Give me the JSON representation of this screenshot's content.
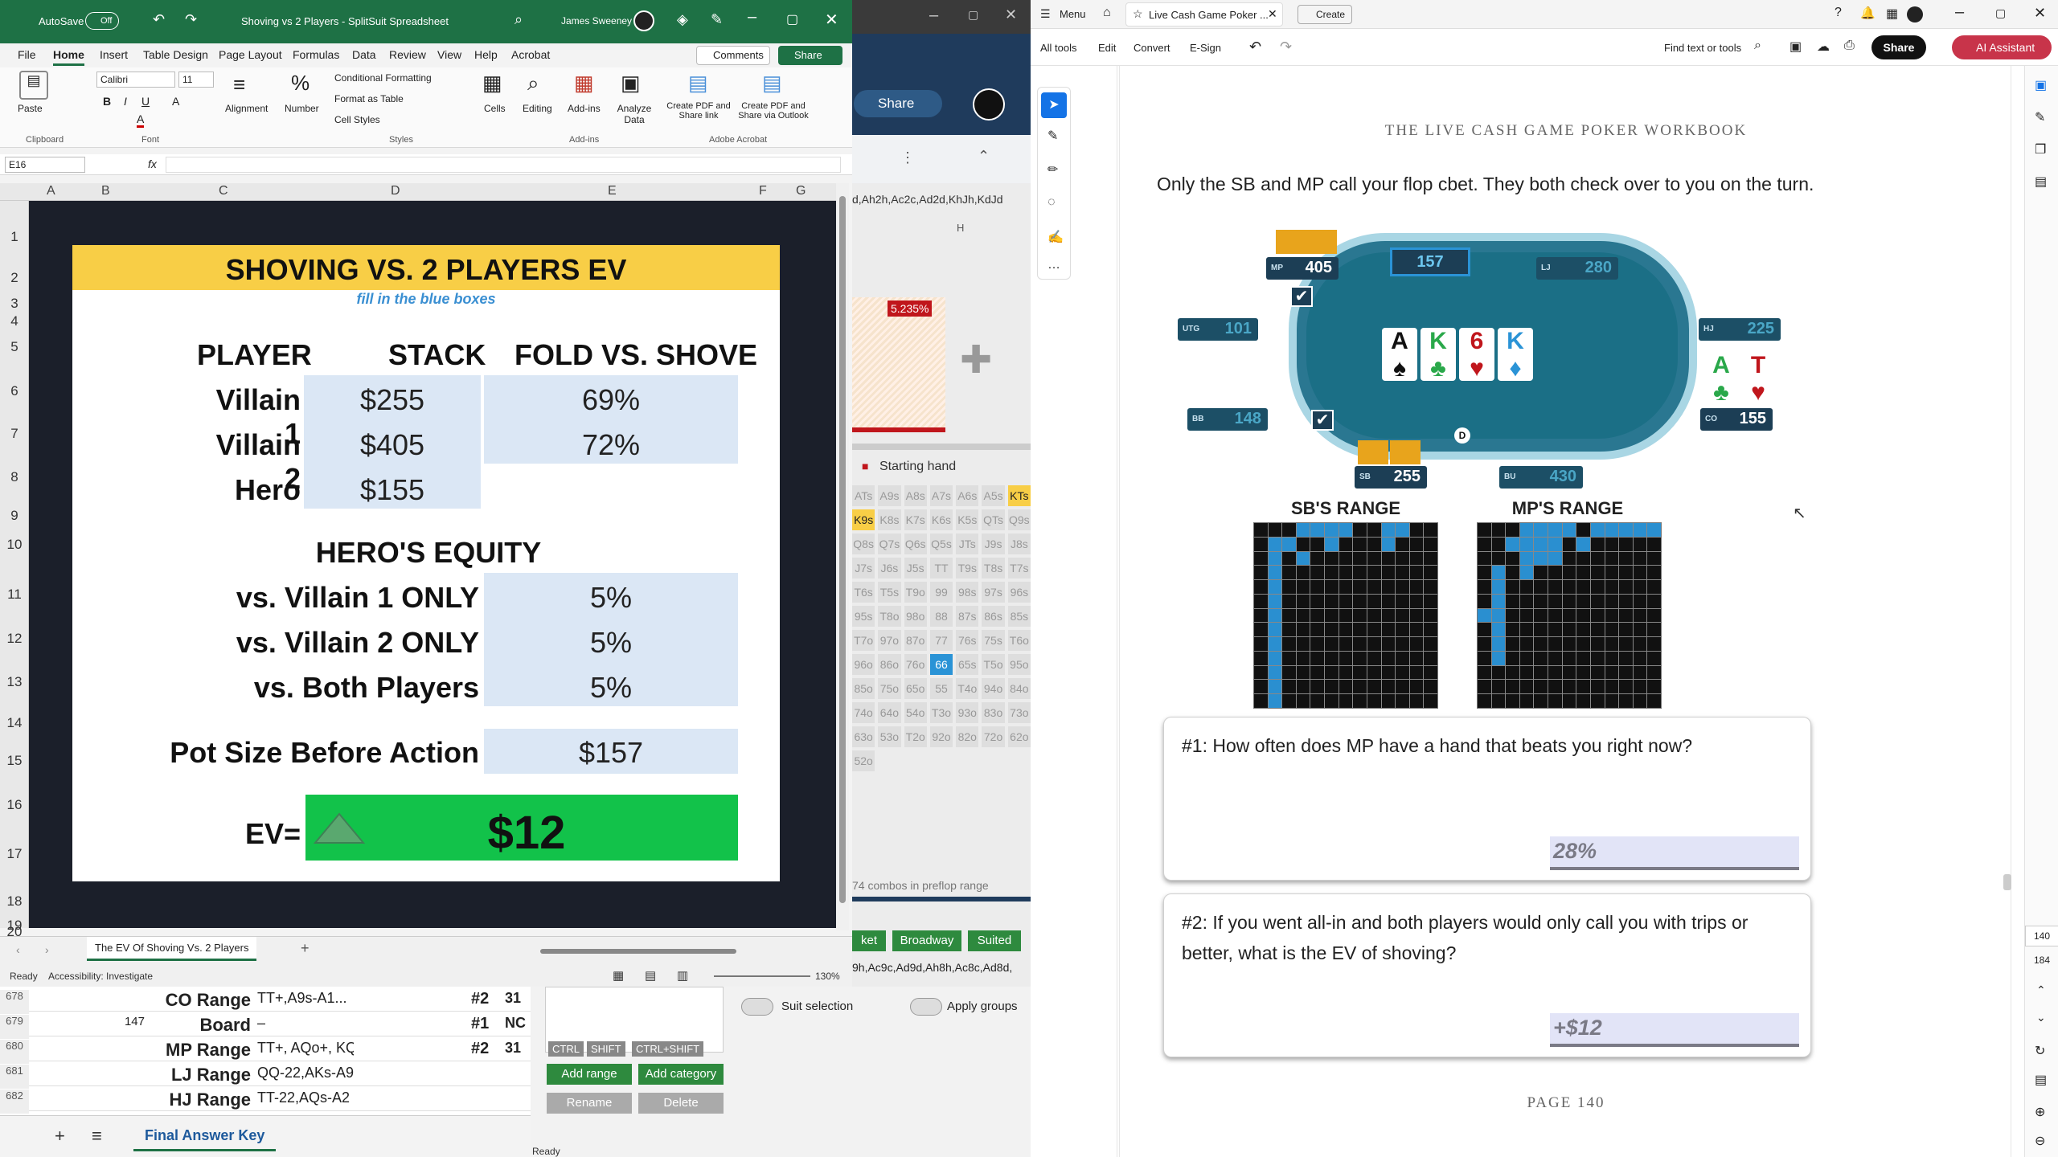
{
  "excel": {
    "autosave": "AutoSave",
    "autosave_state": "Off",
    "file_title": "Shoving vs 2 Players - SplitSuit Spreadsheet",
    "user": "James Sweeney",
    "tabs": [
      "File",
      "Home",
      "Insert",
      "Table Design",
      "Page Layout",
      "Formulas",
      "Data",
      "Review",
      "View",
      "Help",
      "Acrobat"
    ],
    "comments_label": "Comments",
    "share_label": "Share",
    "ribbon": {
      "paste": "Paste",
      "font_name": "Calibri",
      "font_size": "11",
      "alignment": "Alignment",
      "number": "Number",
      "cond_fmt": "Conditional Formatting",
      "format_table": "Format as Table",
      "cell_styles": "Cell Styles",
      "cells": "Cells",
      "editing": "Editing",
      "addins": "Add-ins",
      "analyze": "Analyze Data",
      "create_pdf": "Create PDF and Share link",
      "create_pdf_outlook": "Create PDF and Share via Outlook",
      "grp_clipboard": "Clipboard",
      "grp_font": "Font",
      "grp_styles": "Styles",
      "grp_addins": "Add-ins",
      "grp_acrobat": "Adobe Acrobat"
    },
    "name_box": "E16",
    "fx": "fx",
    "columns": [
      "A",
      "B",
      "C",
      "D",
      "E",
      "F",
      "G"
    ],
    "rows": [
      "1",
      "2",
      "3",
      "4",
      "5",
      "6",
      "7",
      "8",
      "9",
      "10",
      "11",
      "12",
      "13",
      "14",
      "15",
      "16",
      "17",
      "18",
      "19",
      "20"
    ],
    "sheet_tab": "The EV Of Shoving Vs. 2 Players",
    "status_ready": "Ready",
    "accessibility": "Accessibility: Investigate",
    "zoom": "130%"
  },
  "card": {
    "title": "SHOVING VS. 2 PLAYERS EV",
    "subtitle": "fill in the blue boxes",
    "hdr_player": "PLAYER",
    "hdr_stack": "STACK",
    "hdr_fold": "FOLD VS. SHOVE",
    "players": [
      {
        "name": "Villain 1",
        "stack": "$255",
        "fold": "69%"
      },
      {
        "name": "Villain 2",
        "stack": "$405",
        "fold": "72%"
      },
      {
        "name": "Hero",
        "stack": "$155",
        "fold": ""
      }
    ],
    "equity_hdr": "HERO'S EQUITY",
    "equity": [
      {
        "label": "vs. Villain 1 ONLY",
        "value": "5%"
      },
      {
        "label": "vs. Villain 2 ONLY",
        "value": "5%"
      },
      {
        "label": "vs. Both Players",
        "value": "5%"
      }
    ],
    "pot_label": "Pot Size Before Action",
    "pot_value": "$157",
    "ev_label": "EV=",
    "ev_value": "$12"
  },
  "excel_lower": {
    "rows": [
      {
        "num": "678",
        "b": "",
        "c": "CO Range",
        "d": "TT+,A9s-A1...",
        "e": "#2",
        "f": "31"
      },
      {
        "num": "679",
        "b": "147",
        "c": "Board",
        "d": "–",
        "e": "#1",
        "f": "NC"
      },
      {
        "num": "680",
        "b": "",
        "c": "MP Range",
        "d": "TT+, AQo+, KQ",
        "e": "#2",
        "f": "31"
      },
      {
        "num": "681",
        "b": "",
        "c": "LJ Range",
        "d": "QQ-22,AKs-A9",
        "e": "",
        "f": ""
      },
      {
        "num": "682",
        "b": "",
        "c": "HJ Range",
        "d": "TT-22,AQs-A2",
        "e": "",
        "f": ""
      }
    ],
    "sheet_tab": "Final Answer Key"
  },
  "middle": {
    "share": "Share",
    "combo_text": "d,Ah2h,Ac2c,Ad2d,KhJh,KdJd",
    "col_h": "H",
    "pct_badge": "5.235%",
    "starting_hand": "Starting hand",
    "grid": [
      "ATs",
      "A9s",
      "A8s",
      "A7s",
      "A6s",
      "A5s",
      "KTs",
      "K9s",
      "K8s",
      "K7s",
      "K6s",
      "K5s",
      "QTs",
      "Q9s",
      "Q8s",
      "Q7s",
      "Q6s",
      "Q5s",
      "JTs",
      "J9s",
      "J8s",
      "J7s",
      "J6s",
      "J5s",
      "TT",
      "T9s",
      "T8s",
      "T7s",
      "T6s",
      "T5s",
      "T9o",
      "99",
      "98s",
      "97s",
      "96s",
      "95s",
      "T8o",
      "98o",
      "88",
      "87s",
      "86s",
      "85s",
      "T7o",
      "97o",
      "87o",
      "77",
      "76s",
      "75s",
      "T6o",
      "96o",
      "86o",
      "76o",
      "66",
      "65s",
      "T5o",
      "95o",
      "85o",
      "75o",
      "65o",
      "55",
      "T4o",
      "94o",
      "84o",
      "74o",
      "64o",
      "54o",
      "T3o",
      "93o",
      "83o",
      "73o",
      "63o",
      "53o",
      "T2o",
      "92o",
      "82o",
      "72o",
      "62o",
      "52o"
    ],
    "combos": "74 combos in preflop range",
    "btn_bet": "ket",
    "btn_broadway": "Broadway",
    "btn_suited": "Suited",
    "combo_text2": "9h,Ac9c,Ad9d,Ah8h,Ac8c,Ad8d,",
    "suit_sel": "Suit selection",
    "apply_groups": "Apply groups",
    "keys": [
      "CTRL",
      "SHIFT",
      "CTRL+SHIFT"
    ],
    "add_range": "Add range",
    "add_category": "Add category",
    "rename": "Rename",
    "delete": "Delete",
    "ready": "Ready"
  },
  "acrobat": {
    "menu": "Menu",
    "tab_title": "Live Cash Game Poker ...",
    "create": "Create",
    "tools": [
      "All tools",
      "Edit",
      "Convert",
      "E-Sign"
    ],
    "find": "Find text or tools",
    "share": "Share",
    "ai": "AI Assistant",
    "running_head": "THE LIVE CASH GAME POKER WORKBOOK",
    "intro": "Only the SB and MP call your flop cbet. They both check over to you on the turn.",
    "seats": [
      {
        "pos": "MP",
        "stack": "405"
      },
      {
        "pos": "LJ",
        "stack": "280"
      },
      {
        "pos": "UTG",
        "stack": "101"
      },
      {
        "pos": "HJ",
        "stack": "225"
      },
      {
        "pos": "BB",
        "stack": "148"
      },
      {
        "pos": "CO",
        "stack": "155"
      },
      {
        "pos": "SB",
        "stack": "255"
      },
      {
        "pos": "BU",
        "stack": "430"
      }
    ],
    "pot": "157",
    "dealer": "D",
    "board": [
      {
        "rank": "A",
        "suit": "♠",
        "color": "#111"
      },
      {
        "rank": "K",
        "suit": "♣",
        "color": "#2aa84a"
      },
      {
        "rank": "6",
        "suit": "♥",
        "color": "#c0161c"
      },
      {
        "rank": "K",
        "suit": "♦",
        "color": "#2a93d6"
      }
    ],
    "hero": [
      {
        "rank": "A",
        "suit": "♣",
        "color": "#2aa84a"
      },
      {
        "rank": "T",
        "suit": "♥",
        "color": "#c0161c"
      }
    ],
    "sb_range": "SB'S RANGE",
    "mp_range": "MP'S RANGE",
    "q1": "#1: How often does MP have a hand that beats you right now?",
    "a1": "28%",
    "q2": "#2: If you went all-in and both players would only call you with trips or better, what is the EV of shoving?",
    "a2": "+$12",
    "page_footer": "PAGE 140",
    "page_num_current": "140",
    "page_num_total": "184"
  },
  "colors": {
    "excel_green": "#1e7145",
    "card_yellow": "#f8ce46",
    "ev_green": "#12c24a",
    "input_blue": "#dbe7f5",
    "table_teal": "#1b6f86",
    "ai_red": "#c8344a"
  }
}
